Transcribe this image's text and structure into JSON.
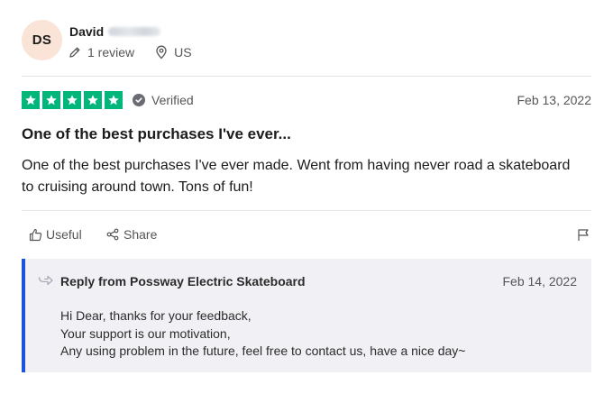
{
  "reviewer": {
    "initials": "DS",
    "name": "David",
    "reviews": "1 review",
    "country": "US"
  },
  "review": {
    "rating": 5,
    "rating_max": 5,
    "verified_label": "Verified",
    "date": "Feb 13, 2022",
    "title": "One of the best purchases I've ever...",
    "body": "One of the best purchases I've ever made. Went from having never road a skateboard to cruising around town. Tons of fun!"
  },
  "actions": {
    "useful_label": "Useful",
    "share_label": "Share"
  },
  "reply": {
    "title": "Reply from Possway Electric Skateboard",
    "date": "Feb 14, 2022",
    "lines": [
      "Hi Dear, thanks for your feedback,",
      "Your support is our motivation,",
      "Any using problem in the future, feel free to contact us, have a nice day~"
    ]
  },
  "colors": {
    "star_green": "#00b67a",
    "avatar_bg": "#f9e4d7",
    "reply_bg": "#f1f1f5",
    "reply_border": "#1a55df"
  },
  "icons": {
    "meta_reviews": "pencil-icon",
    "meta_location": "location-pin-icon",
    "verified": "check-circle-icon",
    "useful": "thumbs-up-icon",
    "share": "share-icon",
    "report": "flag-icon",
    "reply": "reply-arrow-icon"
  }
}
